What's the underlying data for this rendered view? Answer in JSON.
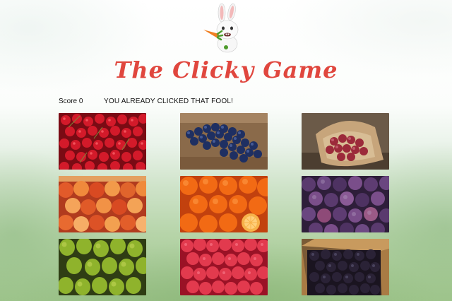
{
  "header": {
    "title": "The Clicky Game",
    "mascot_icon": "rabbit-with-carrot-icon"
  },
  "status": {
    "score_label": "Score 0",
    "message": "YOU ALREADY CLICKED THAT FOOL!"
  },
  "cards": [
    {
      "icon": "cherries-icon"
    },
    {
      "icon": "blueberries-icon"
    },
    {
      "icon": "red-grapes-icon"
    },
    {
      "icon": "peaches-icon"
    },
    {
      "icon": "oranges-icon"
    },
    {
      "icon": "plums-icon"
    },
    {
      "icon": "pears-icon"
    },
    {
      "icon": "raspberries-icon"
    },
    {
      "icon": "blackberries-icon"
    }
  ],
  "colors": {
    "title": "#e0473e",
    "text": "#111111"
  }
}
